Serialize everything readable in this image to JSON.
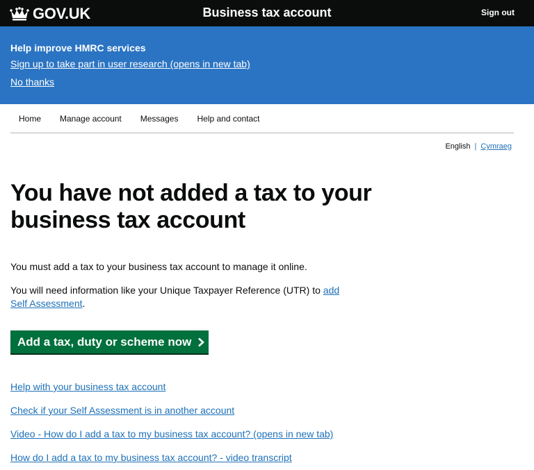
{
  "header": {
    "logo_text": "GOV.UK",
    "service_name": "Business tax account",
    "sign_out": "Sign out"
  },
  "banner": {
    "title": "Help improve HMRC services",
    "signup_link": "Sign up to take part in user research (opens in new tab)",
    "no_thanks": "No thanks"
  },
  "nav": {
    "items": [
      "Home",
      "Manage account",
      "Messages",
      "Help and contact"
    ]
  },
  "language": {
    "current": "English",
    "separator": "|",
    "other": "Cymraeg"
  },
  "main": {
    "title": "You have not added a tax to your business tax account",
    "para1": "You must add a tax to your business tax account to manage it online.",
    "para2_text": "You will need information like your Unique Taxpayer Reference (UTR) to ",
    "para2_link": "add Self Assessment",
    "para2_end": ".",
    "start_button": "Add a tax, duty or scheme now",
    "links": [
      "Help with your business tax account",
      "Check if your Self Assessment is in another account",
      "Video - How do I add a tax to my business tax account? (opens in new tab)",
      "How do I add a tax to my business tax account? - video transcript"
    ]
  },
  "colors": {
    "header_bg": "#0b0c0c",
    "banner_bg": "#2b74c3",
    "link": "#1d70b8",
    "button_bg": "#00703c"
  },
  "icons": [
    "crown-icon",
    "chevron-right-icon"
  ]
}
